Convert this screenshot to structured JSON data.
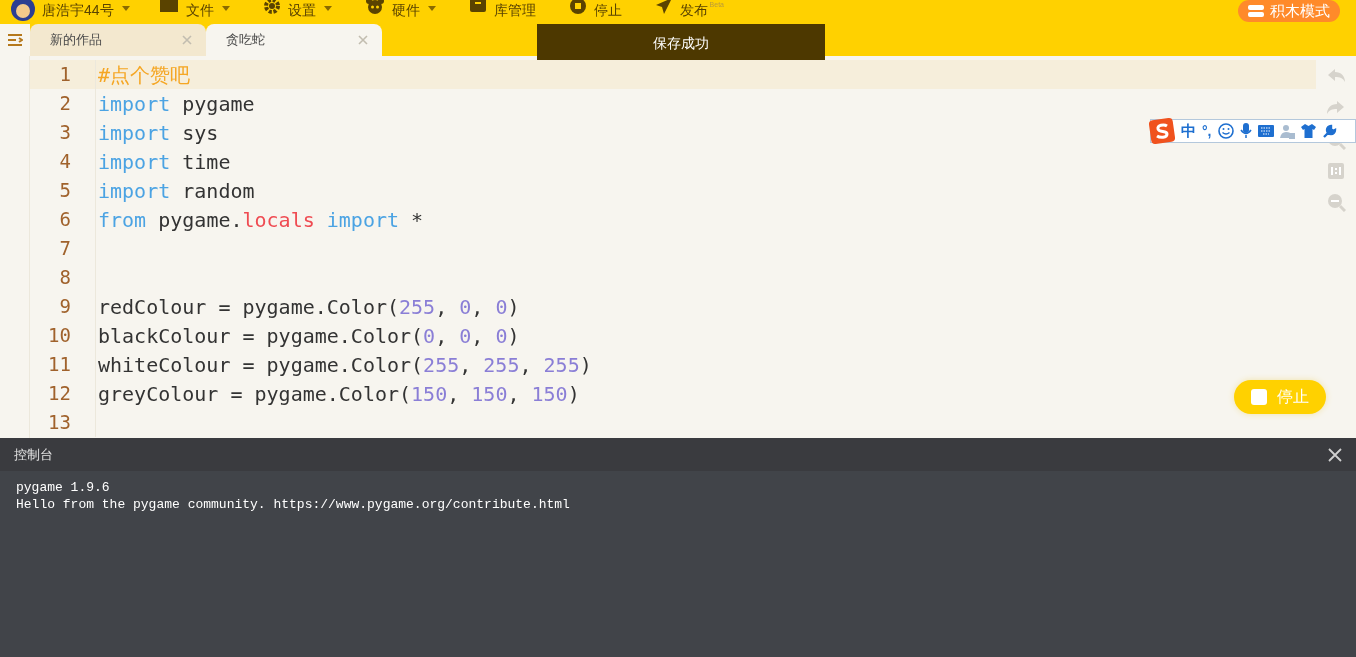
{
  "top_menu": {
    "user": "唐浩宇44号",
    "items": [
      {
        "label": "文件",
        "dropdown": true
      },
      {
        "label": "设置",
        "dropdown": true
      },
      {
        "label": "硬件",
        "dropdown": true
      },
      {
        "label": "库管理",
        "dropdown": false
      },
      {
        "label": "停止",
        "dropdown": false
      },
      {
        "label": "发布",
        "dropdown": false,
        "badge": "Beta"
      }
    ],
    "mode_button": "积木模式"
  },
  "tabs": [
    {
      "label": "新的作品",
      "selected": false
    },
    {
      "label": "贪吃蛇",
      "selected": true
    }
  ],
  "toast": "保存成功",
  "editor": {
    "lines": [
      {
        "number": "1",
        "current": true,
        "tokens": [
          {
            "kind": "comment",
            "text": "#点个赞吧"
          }
        ]
      },
      {
        "number": "2",
        "current": false,
        "tokens": [
          {
            "kind": "keyword",
            "text": "import"
          },
          {
            "kind": "plain",
            "text": " pygame"
          }
        ]
      },
      {
        "number": "3",
        "current": false,
        "tokens": [
          {
            "kind": "keyword",
            "text": "import"
          },
          {
            "kind": "plain",
            "text": " sys"
          }
        ]
      },
      {
        "number": "4",
        "current": false,
        "tokens": [
          {
            "kind": "keyword",
            "text": "import"
          },
          {
            "kind": "plain",
            "text": " time"
          }
        ]
      },
      {
        "number": "5",
        "current": false,
        "tokens": [
          {
            "kind": "keyword",
            "text": "import"
          },
          {
            "kind": "plain",
            "text": " random"
          }
        ]
      },
      {
        "number": "6",
        "current": false,
        "tokens": [
          {
            "kind": "keyword",
            "text": "from"
          },
          {
            "kind": "plain",
            "text": " pygame."
          },
          {
            "kind": "attr",
            "text": "locals"
          },
          {
            "kind": "keyword",
            "text": " import"
          },
          {
            "kind": "plain",
            "text": " *"
          }
        ]
      },
      {
        "number": "7",
        "current": false
      },
      {
        "number": "8",
        "current": false
      },
      {
        "number": "9",
        "current": false,
        "tokens": [
          {
            "kind": "plain",
            "text": "redColour = pygame.Color("
          },
          {
            "kind": "number",
            "text": "255"
          },
          {
            "kind": "plain",
            "text": ", "
          },
          {
            "kind": "number",
            "text": "0"
          },
          {
            "kind": "plain",
            "text": ", "
          },
          {
            "kind": "number",
            "text": "0"
          },
          {
            "kind": "plain",
            "text": ")"
          }
        ]
      },
      {
        "number": "10",
        "current": false,
        "tokens": [
          {
            "kind": "plain",
            "text": "blackColour = pygame.Color("
          },
          {
            "kind": "number",
            "text": "0"
          },
          {
            "kind": "plain",
            "text": ", "
          },
          {
            "kind": "number",
            "text": "0"
          },
          {
            "kind": "plain",
            "text": ", "
          },
          {
            "kind": "number",
            "text": "0"
          },
          {
            "kind": "plain",
            "text": ")"
          }
        ]
      },
      {
        "number": "11",
        "current": false,
        "tokens": [
          {
            "kind": "plain",
            "text": "whiteColour = pygame.Color("
          },
          {
            "kind": "number",
            "text": "255"
          },
          {
            "kind": "plain",
            "text": ", "
          },
          {
            "kind": "number",
            "text": "255"
          },
          {
            "kind": "plain",
            "text": ", "
          },
          {
            "kind": "number",
            "text": "255"
          },
          {
            "kind": "plain",
            "text": ")"
          }
        ]
      },
      {
        "number": "12",
        "current": false,
        "tokens": [
          {
            "kind": "plain",
            "text": "greyColour = pygame.Color("
          },
          {
            "kind": "number",
            "text": "150"
          },
          {
            "kind": "plain",
            "text": ", "
          },
          {
            "kind": "number",
            "text": "150"
          },
          {
            "kind": "plain",
            "text": ", "
          },
          {
            "kind": "number",
            "text": "150"
          },
          {
            "kind": "plain",
            "text": ")"
          }
        ]
      },
      {
        "number": "13",
        "current": false
      }
    ]
  },
  "ime_toolbar": {
    "chinese": "中",
    "punct": "°,"
  },
  "run_button": "停止",
  "console": {
    "title": "控制台",
    "lines": [
      "pygame 1.9.6",
      "Hello from the pygame community. https://www.pygame.org/contribute.html"
    ]
  }
}
